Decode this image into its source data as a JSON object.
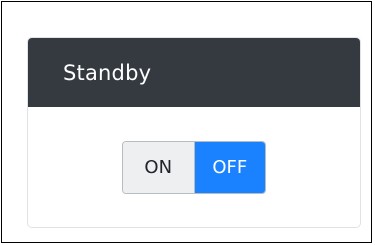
{
  "panel": {
    "title": "Standby"
  },
  "toggle": {
    "on_label": "ON",
    "off_label": "OFF",
    "selected": "OFF"
  },
  "colors": {
    "header_bg": "#343a40",
    "selected_bg": "#1b82ff",
    "unselected_bg": "#eeeff1"
  }
}
